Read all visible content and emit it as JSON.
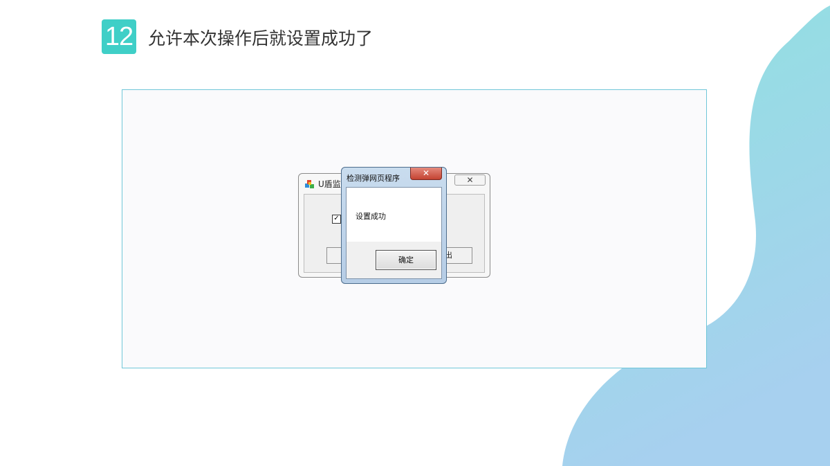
{
  "step": {
    "number": "12",
    "title": "允许本次操作后就设置成功了"
  },
  "background_window": {
    "title": "U盾监",
    "close_glyph": "✕",
    "checkbox_checked": true,
    "check_glyph": "✓",
    "right_button_fragment": "出"
  },
  "dialog": {
    "title": "检测弹网页程序",
    "close_glyph": "✕",
    "message": "设置成功",
    "ok_label": "确定"
  },
  "colors": {
    "badge": "#3fcfc7",
    "blob_top": "#8fe2df",
    "blob_bottom": "#a7d0ef",
    "frame_border": "#6fc6d8"
  }
}
